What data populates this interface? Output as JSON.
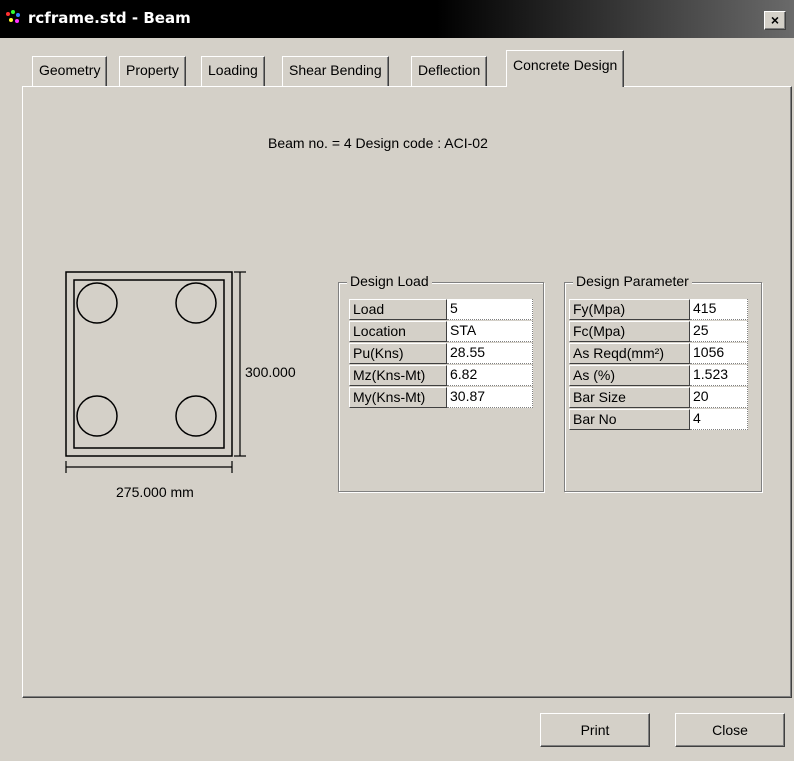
{
  "window": {
    "title": "rcframe.std - Beam",
    "close_glyph": "×"
  },
  "tabs": [
    {
      "label": "Geometry"
    },
    {
      "label": "Property"
    },
    {
      "label": "Loading"
    },
    {
      "label": "Shear Bending"
    },
    {
      "label": "Deflection"
    },
    {
      "label": "Concrete Design",
      "active": true
    }
  ],
  "heading": "Beam no. = 4  Design code :  ACI-02",
  "section": {
    "height_label": "300.000",
    "width_label": "275.000 mm",
    "bar_count": 4
  },
  "design_load": {
    "title": "Design Load",
    "rows": [
      {
        "label": "Load",
        "value": "5"
      },
      {
        "label": "Location",
        "value": "STA"
      },
      {
        "label": "Pu(Kns)",
        "value": "28.55"
      },
      {
        "label": "Mz(Kns-Mt)",
        "value": "6.82"
      },
      {
        "label": "My(Kns-Mt)",
        "value": "30.87"
      }
    ]
  },
  "design_parameter": {
    "title": "Design Parameter",
    "rows": [
      {
        "label": "Fy(Mpa)",
        "value": "415"
      },
      {
        "label": "Fc(Mpa)",
        "value": "25"
      },
      {
        "label": "As Reqd(mm²)",
        "value": "1056"
      },
      {
        "label": "As (%)",
        "value": "1.523"
      },
      {
        "label": "Bar Size",
        "value": "20"
      },
      {
        "label": "Bar No",
        "value": "4"
      }
    ]
  },
  "buttons": {
    "print": "Print",
    "close": "Close"
  }
}
